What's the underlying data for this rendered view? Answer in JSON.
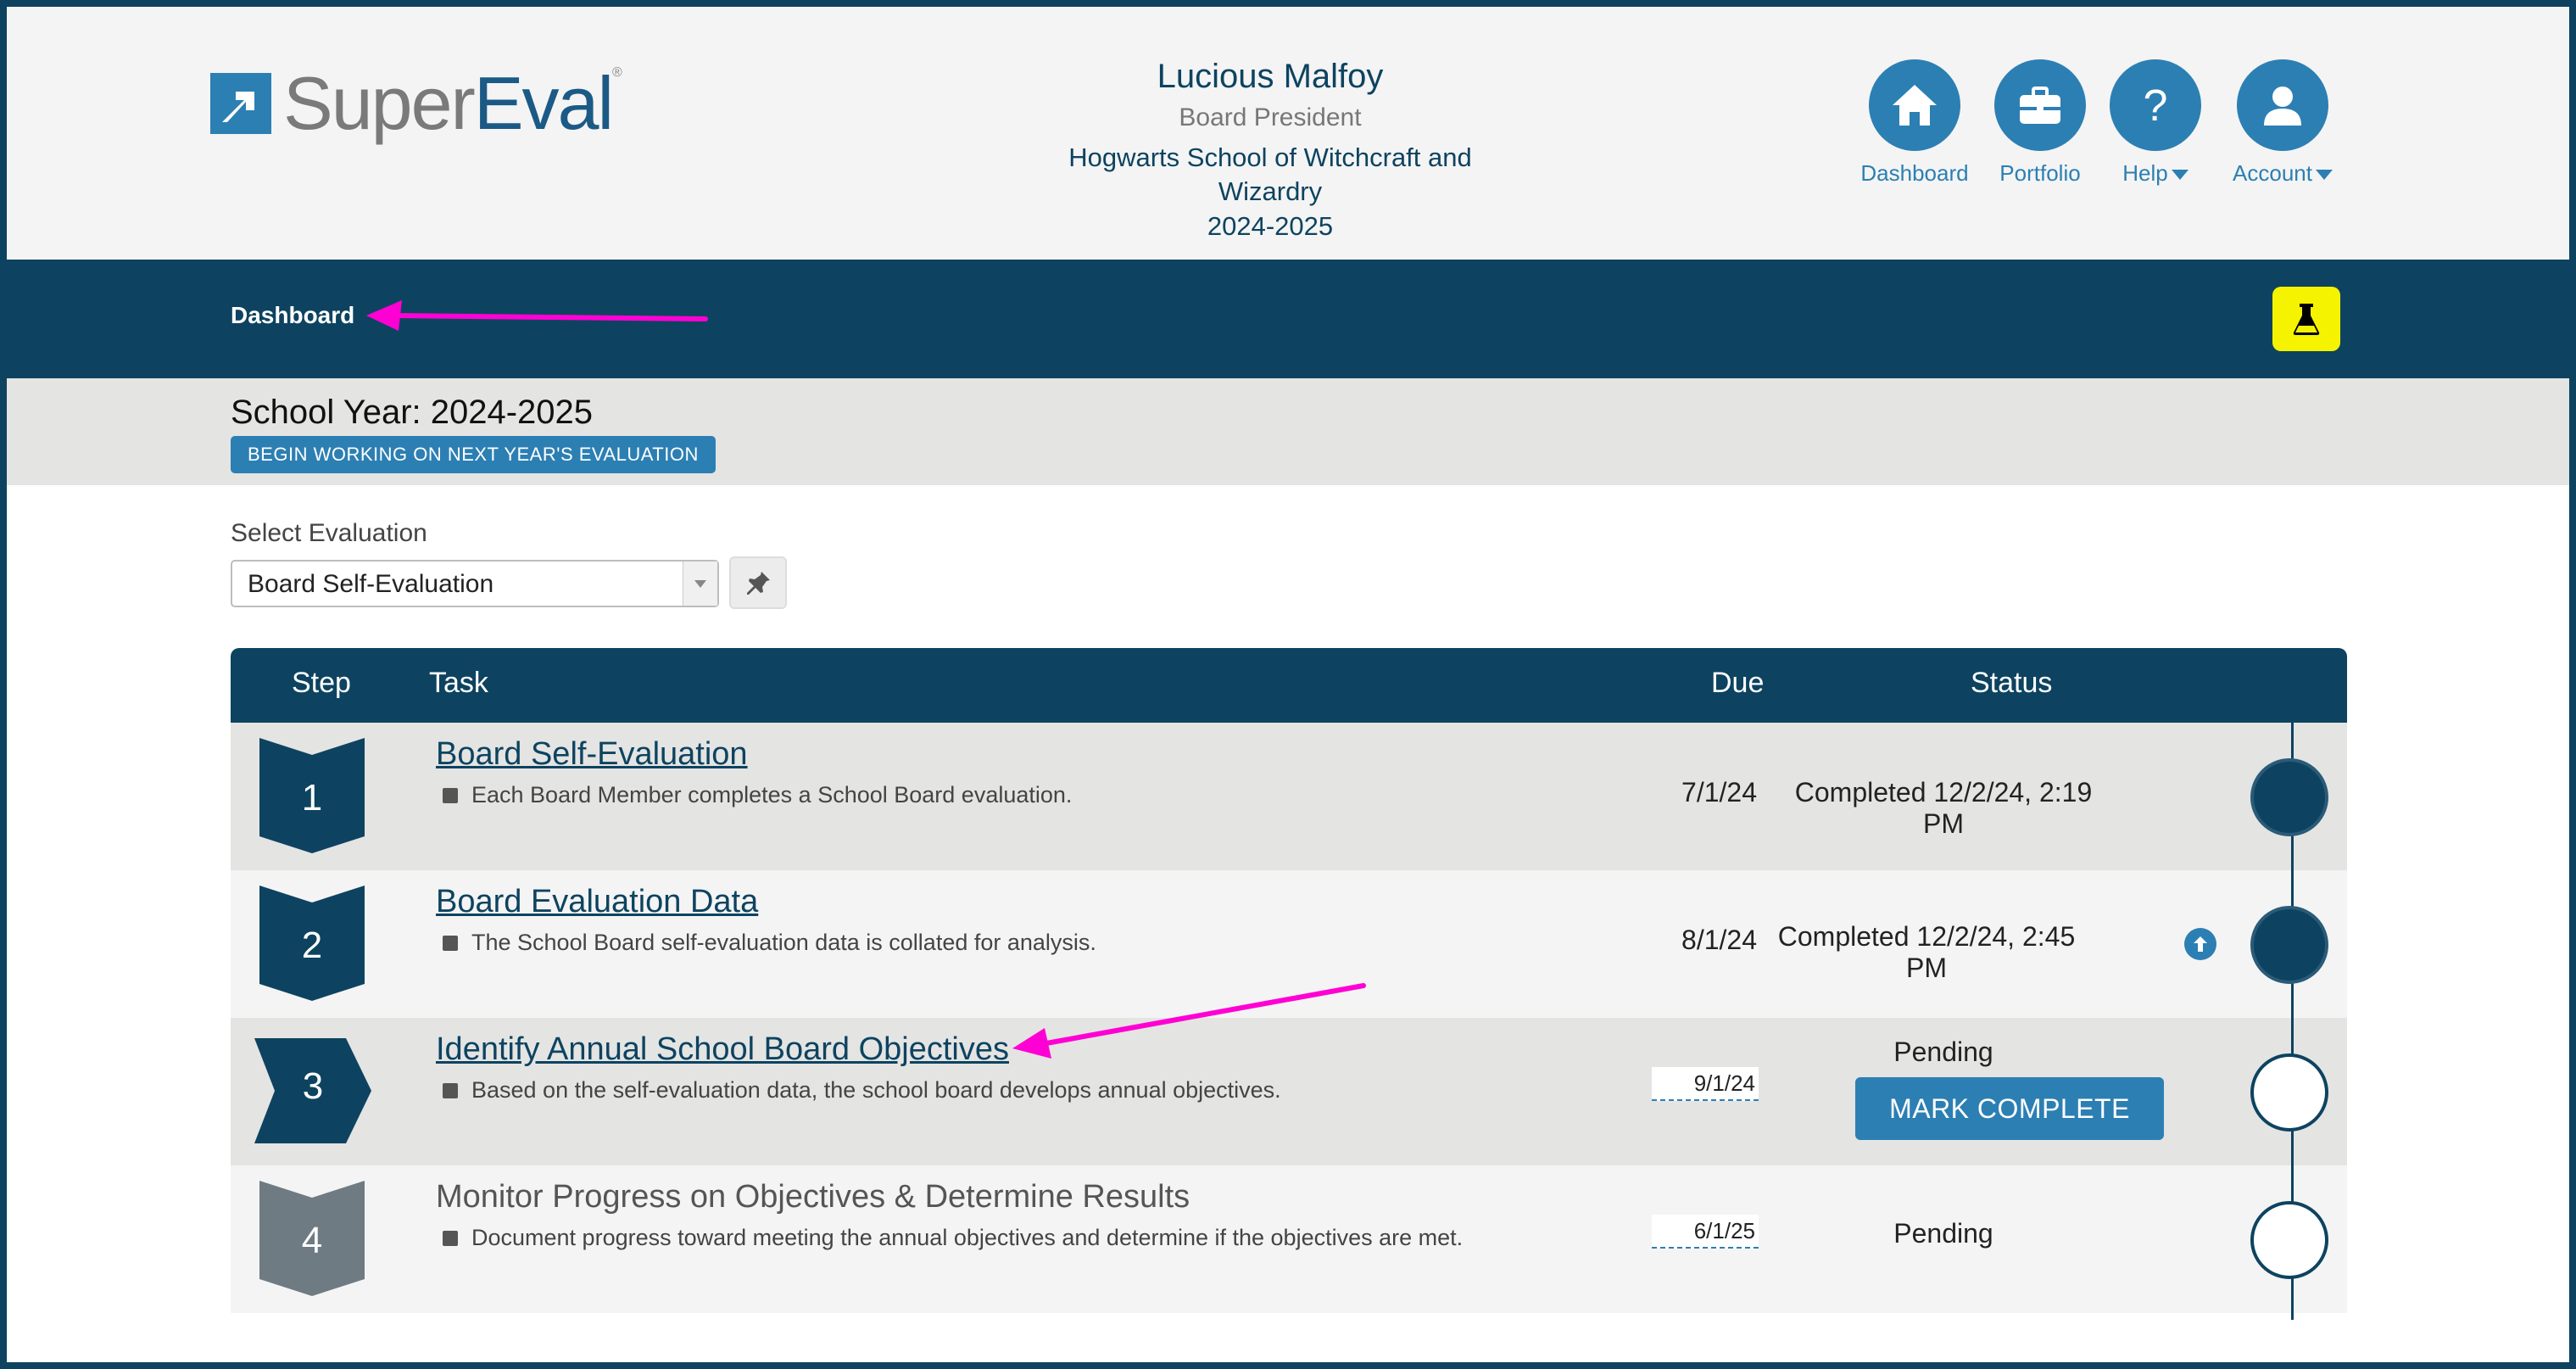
{
  "brand": {
    "name_part1": "Super",
    "name_part2": "Eval",
    "reg": "®"
  },
  "user": {
    "name": "Lucious Malfoy",
    "role": "Board President",
    "school": "Hogwarts School of Witchcraft and Wizardry",
    "year": "2024-2025"
  },
  "top_nav": [
    {
      "label": "Dashboard",
      "icon": "home-icon"
    },
    {
      "label": "Portfolio",
      "icon": "briefcase-icon"
    },
    {
      "label": "Help",
      "icon": "question-icon"
    },
    {
      "label": "Account",
      "icon": "user-icon"
    }
  ],
  "breadcrumb": "Dashboard",
  "school_year": {
    "label": "School Year: 2024-2025",
    "next_year_button": "BEGIN WORKING ON NEXT YEAR'S EVALUATION"
  },
  "evaluation_select": {
    "label": "Select Evaluation",
    "selected": "Board Self-Evaluation"
  },
  "table": {
    "headers": {
      "step": "Step",
      "task": "Task",
      "due": "Due",
      "status": "Status"
    },
    "rows": [
      {
        "step": "1",
        "title": "Board Self-Evaluation",
        "description": "Each Board Member completes a School Board evaluation.",
        "due": "7/1/24",
        "status": "Completed 12/2/24, 2:19 PM"
      },
      {
        "step": "2",
        "title": "Board Evaluation Data",
        "description": "The School Board self-evaluation data is collated for analysis.",
        "due": "8/1/24",
        "status": "Completed 12/2/24, 2:45 PM"
      },
      {
        "step": "3",
        "title": "Identify Annual School Board Objectives",
        "description": "Based on the self-evaluation data, the school board develops annual objectives.",
        "due": "9/1/24",
        "status": "Pending",
        "action": "MARK COMPLETE"
      },
      {
        "step": "4",
        "title": "Monitor Progress on Objectives & Determine Results",
        "description": "Document progress toward meeting the annual objectives and determine if the objectives are met.",
        "due": "6/1/25",
        "status": "Pending"
      }
    ]
  },
  "colors": {
    "navy": "#0d4360",
    "accent_blue": "#2c7fb3",
    "lab_yellow": "#f5f300",
    "annotation_magenta": "#ff00d4"
  }
}
